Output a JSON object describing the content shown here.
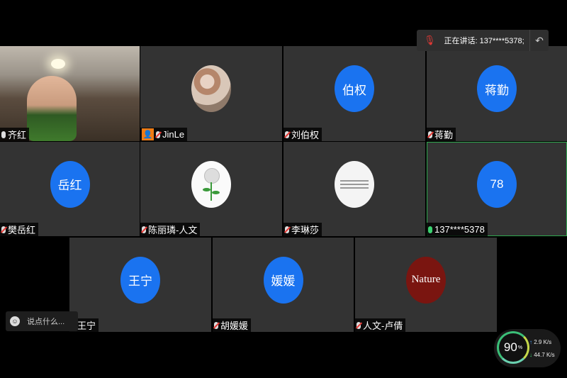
{
  "speaking": {
    "label": "正在讲话: 137****5378;"
  },
  "tiles": [
    {
      "name": "齐红",
      "mic": "on",
      "avatar": ""
    },
    {
      "name": "JinLe",
      "mic": "muted",
      "avatar": ""
    },
    {
      "name": "刘伯权",
      "mic": "muted",
      "avatar": "伯权"
    },
    {
      "name": "蒋勤",
      "mic": "muted",
      "avatar": "蒋勤"
    },
    {
      "name": "樊岳红",
      "mic": "muted",
      "avatar": "岳红"
    },
    {
      "name": "陈丽璘-人文",
      "mic": "muted",
      "avatar": ""
    },
    {
      "name": "李琳莎",
      "mic": "muted",
      "avatar": ""
    },
    {
      "name": "137****5378",
      "mic": "on",
      "avatar": "78"
    },
    {
      "name": "王宁",
      "mic": "muted",
      "avatar": "王宁"
    },
    {
      "name": "胡媛媛",
      "mic": "muted",
      "avatar": "媛媛"
    },
    {
      "name": "人文-卢倩",
      "mic": "muted",
      "avatar": "Nature"
    }
  ],
  "chat": {
    "placeholder": "说点什么..."
  },
  "network": {
    "quality": "90",
    "unit": "%",
    "upload": "2.9",
    "download": "44.7",
    "rate_unit": "K/s"
  },
  "colors": {
    "avatar_blue": "#1a73f0",
    "avatar_red": "#7a1510",
    "speaking_green": "#2fa84f",
    "muted_red": "#e53935"
  }
}
